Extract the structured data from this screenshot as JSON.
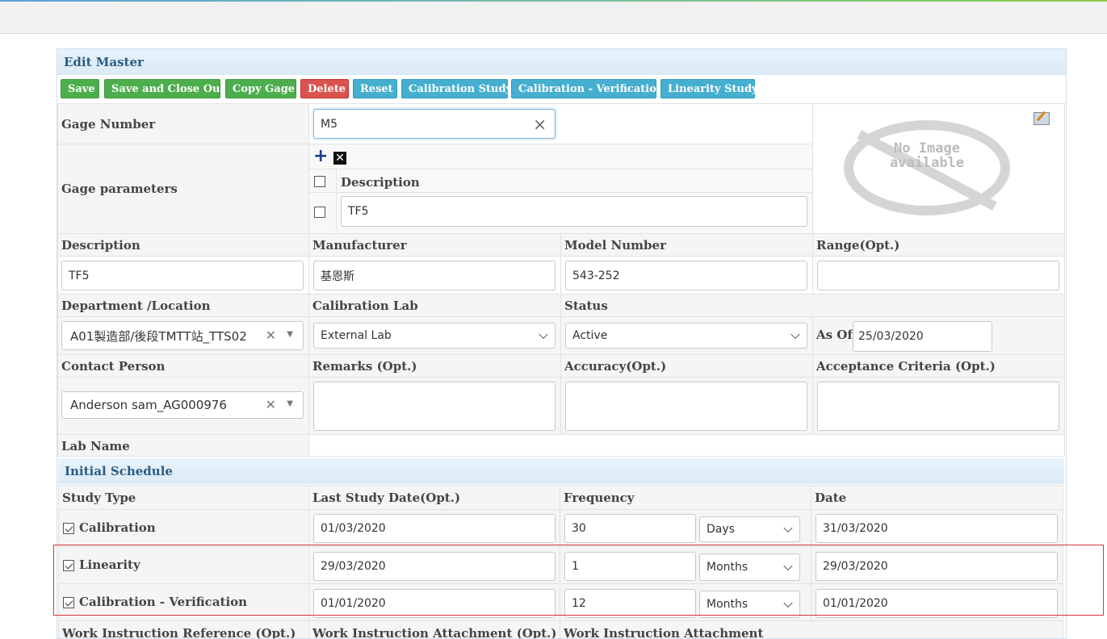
{
  "colors": {
    "save": "#4cae4c",
    "delete": "#d9534f",
    "study": "#46afd0",
    "header_text": "#2a5b85",
    "highlight": "#d9353a"
  },
  "panel_title": "Edit Master",
  "toolbar": {
    "save": "Save",
    "save_close": "Save and Close Out",
    "copy": "Copy Gage",
    "delete": "Delete",
    "reset": "Reset",
    "calibration_study": "Calibration Study",
    "calibration_verification": "Calibration - Verification",
    "linearity_study": "Linearity Study"
  },
  "gage_number": {
    "label": "Gage Number",
    "value": "M5",
    "clear_icon": "×"
  },
  "gage_parameters": {
    "label": "Gage parameters",
    "add_icon": "plus-icon",
    "remove_icon": "remove-icon",
    "column_header": "Description",
    "rows": [
      {
        "value": "TF5"
      }
    ]
  },
  "image": {
    "line1": "No Image",
    "line2": "available",
    "edit_icon": "edit-image-icon"
  },
  "fields": {
    "description": {
      "label": "Description",
      "value": "TF5"
    },
    "manufacturer": {
      "label": "Manufacturer",
      "value": "基恩斯"
    },
    "model_number": {
      "label": "Model Number",
      "value": "543-252"
    },
    "range": {
      "label": "Range(Opt.)",
      "value": ""
    },
    "department": {
      "label": "Department /Location",
      "value": "A01製造部/後段TMTT站_TTS02"
    },
    "calibration_lab": {
      "label": "Calibration Lab",
      "value": "External Lab"
    },
    "status": {
      "label": "Status",
      "value": "Active"
    },
    "as_of": {
      "label": "As Of",
      "value": "25/03/2020"
    },
    "contact_person": {
      "label": "Contact Person",
      "value": "Anderson sam_AG000976"
    },
    "remarks": {
      "label": "Remarks (Opt.)",
      "value": ""
    },
    "accuracy": {
      "label": "Accuracy(Opt.)",
      "value": ""
    },
    "acceptance": {
      "label": "Acceptance Criteria (Opt.)",
      "value": ""
    },
    "lab_name": {
      "label": "Lab Name"
    }
  },
  "schedule": {
    "title": "Initial Schedule",
    "headers": {
      "study_type": "Study Type",
      "last_date": "Last Study Date(Opt.)",
      "frequency": "Frequency",
      "date": "Date"
    },
    "rows": [
      {
        "name": "Calibration",
        "checked": true,
        "last_date": "01/03/2020",
        "freq": "30",
        "unit": "Days",
        "date": "31/03/2020"
      },
      {
        "name": "Linearity",
        "checked": true,
        "last_date": "29/03/2020",
        "freq": "1",
        "unit": "Months",
        "date": "29/03/2020"
      },
      {
        "name": "Calibration - Verification",
        "checked": true,
        "last_date": "01/01/2020",
        "freq": "12",
        "unit": "Months",
        "date": "01/01/2020"
      }
    ]
  },
  "footer_labels": {
    "wi_reference": "Work Instruction Reference (Opt.)",
    "wi_attachment_opt": "Work Instruction Attachment (Opt.)",
    "wi_attachment": "Work Instruction Attachment"
  }
}
